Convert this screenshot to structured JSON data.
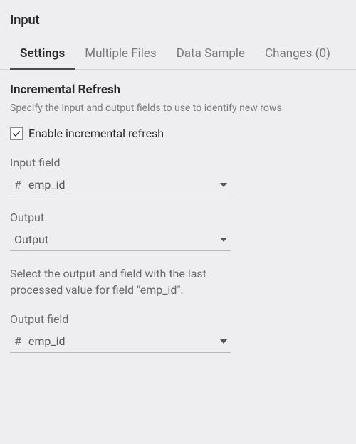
{
  "panel": {
    "title": "Input"
  },
  "tabs": {
    "items": [
      {
        "label": "Settings",
        "active": true
      },
      {
        "label": "Multiple Files",
        "active": false
      },
      {
        "label": "Data Sample",
        "active": false
      },
      {
        "label": "Changes (0)",
        "active": false
      }
    ]
  },
  "section": {
    "title": "Incremental Refresh",
    "description": "Specify the input and output fields to use to identify new rows."
  },
  "enable": {
    "label": "Enable incremental refresh",
    "checked": true
  },
  "inputField": {
    "label": "Input field",
    "iconName": "hash-icon",
    "iconGlyph": "#",
    "value": "emp_id"
  },
  "output": {
    "label": "Output",
    "value": "Output"
  },
  "helpText": "Select the output and field with the last processed value for field \"emp_id\".",
  "outputField": {
    "label": "Output field",
    "iconName": "hash-icon",
    "iconGlyph": "#",
    "value": "emp_id"
  }
}
